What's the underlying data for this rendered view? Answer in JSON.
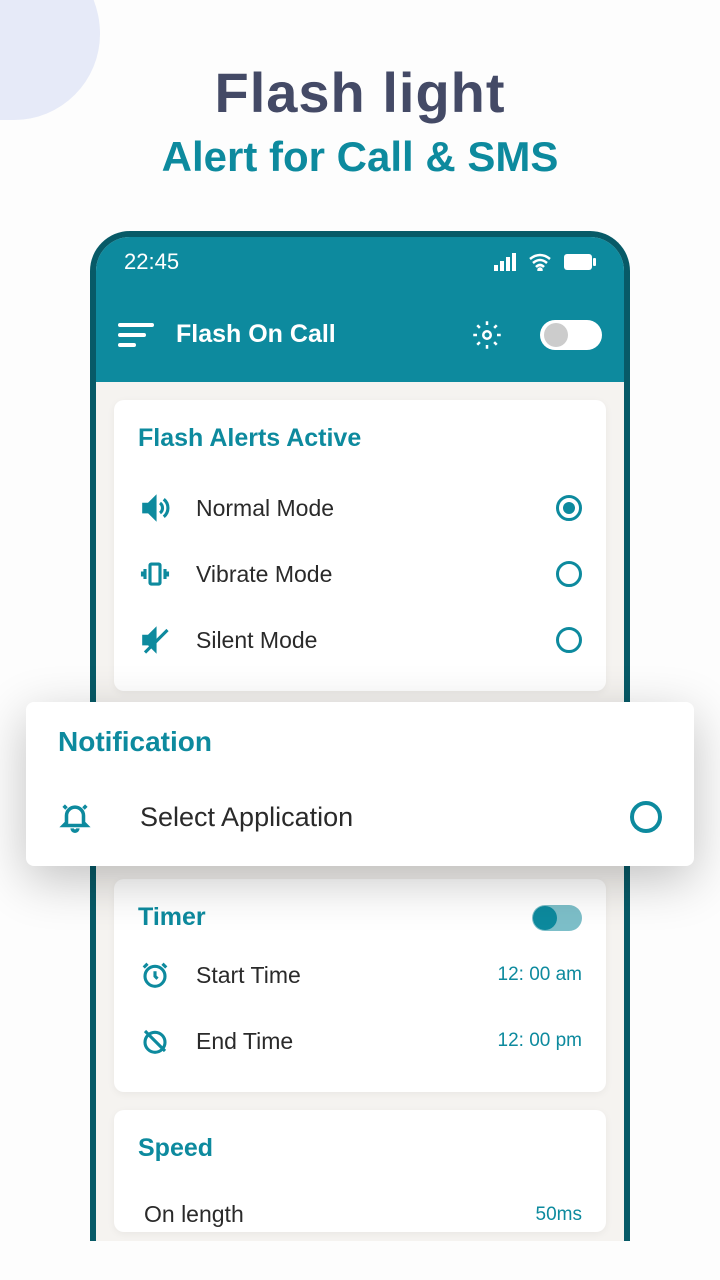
{
  "header": {
    "title": "Flash light",
    "subtitle": "Alert for Call & SMS"
  },
  "status": {
    "time": "22:45"
  },
  "appbar": {
    "title": "Flash On Call"
  },
  "flashAlerts": {
    "title": "Flash Alerts Active",
    "modes": [
      {
        "label": "Normal Mode",
        "selected": true
      },
      {
        "label": "Vibrate Mode",
        "selected": false
      },
      {
        "label": "Silent Mode",
        "selected": false
      }
    ]
  },
  "notification": {
    "title": "Notification",
    "label": "Select Application"
  },
  "timer": {
    "title": "Timer",
    "start": {
      "label": "Start Time",
      "value": "12: 00 am"
    },
    "end": {
      "label": "End Time",
      "value": "12: 00 pm"
    }
  },
  "speed": {
    "title": "Speed",
    "onLength": {
      "label": "On length",
      "value": "50ms"
    }
  }
}
